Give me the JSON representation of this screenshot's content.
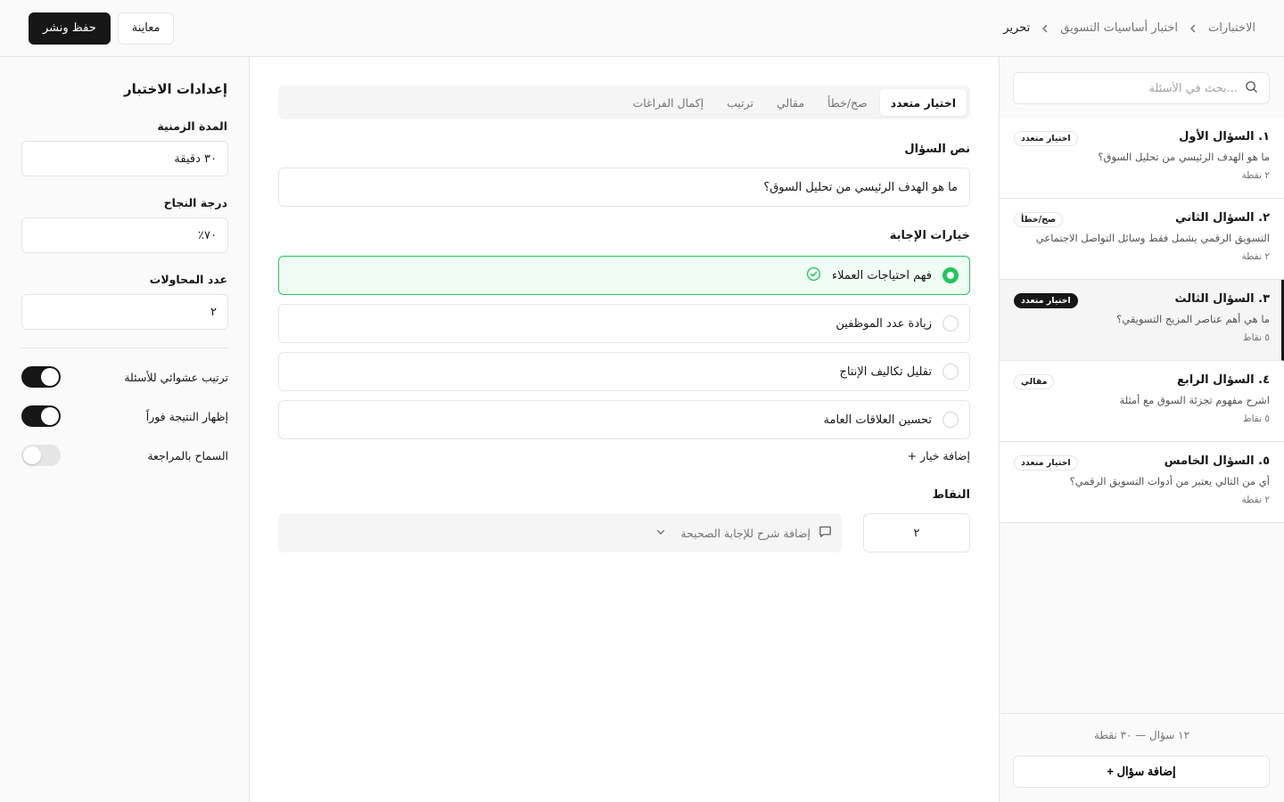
{
  "breadcrumb": {
    "items": [
      "الاختبارات",
      "اختبار أساسيات التسويق",
      "تحرير"
    ]
  },
  "header": {
    "preview_label": "معاينة",
    "publish_label": "حفظ ونشر"
  },
  "questions_panel": {
    "search_placeholder": "...بحث في الأسئلة",
    "items": [
      {
        "title": "١. السؤال الأول",
        "text": "ما هو الهدف الرئيسي من تحليل السوق؟",
        "points": "٢ نقطة",
        "type": "اختيار متعدد",
        "active": false
      },
      {
        "title": "٢. السؤال الثاني",
        "text": "التسويق الرقمي يشمل فقط وسائل التواصل الاجتماعي",
        "points": "٢ نقطة",
        "type": "صح/خطأ",
        "active": false
      },
      {
        "title": "٣. السؤال الثالث",
        "text": "ما هي أهم عناصر المزيج التسويقي؟",
        "points": "٥ نقاط",
        "type": "اختيار متعدد",
        "active": true
      },
      {
        "title": "٤. السؤال الرابع",
        "text": "اشرح مفهوم تجزئة السوق مع أمثلة",
        "points": "٥ نقاط",
        "type": "مقالي",
        "active": false
      },
      {
        "title": "٥. السؤال الخامس",
        "text": "أي من التالي يعتبر من أدوات التسويق الرقمي؟",
        "points": "٢ نقطة",
        "type": "اختيار متعدد",
        "active": false
      }
    ],
    "summary": "١٢ سؤال — ٣٠ نقطة",
    "add_label": "إضافة سؤال +"
  },
  "editor": {
    "tabs": [
      "اختيار متعدد",
      "صح/خطأ",
      "مقالي",
      "ترتيب",
      "إكمال الفراغات"
    ],
    "active_tab": "اختيار متعدد",
    "question_label": "نص السؤال",
    "question_value": "ما هو الهدف الرئيسي من تحليل السوق؟",
    "options_label": "خيارات الإجابة",
    "options": [
      {
        "text": "فهم احتياجات العملاء",
        "correct": true
      },
      {
        "text": "زيادة عدد الموظفين",
        "correct": false
      },
      {
        "text": "تقليل تكاليف الإنتاج",
        "correct": false
      },
      {
        "text": "تحسين العلاقات العامة",
        "correct": false
      }
    ],
    "add_option_label": "إضافة خيار +",
    "points_label": "النقاط",
    "points_value": "٢",
    "explanation_label": "إضافة شرح للإجابة الصحيحة"
  },
  "settings": {
    "title": "إعدادات الاختبار",
    "duration_label": "المدة الزمنية",
    "duration_value": "٣٠ دقيقة",
    "pass_label": "درجة النجاح",
    "pass_value": "٧٠٪",
    "attempts_label": "عدد المحاولات",
    "attempts_value": "٢",
    "toggles": [
      {
        "label": "ترتيب عشوائي للأسئلة",
        "on": true
      },
      {
        "label": "إظهار النتيجة فوراً",
        "on": true
      },
      {
        "label": "السماح بالمراجعة",
        "on": false
      }
    ]
  },
  "colors": {
    "accent": "#171717",
    "correct": "#22c55e",
    "border": "#e5e5e5"
  }
}
